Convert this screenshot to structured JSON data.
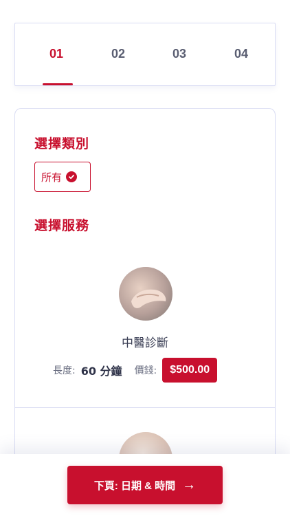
{
  "steps": [
    "01",
    "02",
    "03",
    "04"
  ],
  "category": {
    "title": "選擇類別",
    "chip": "所有"
  },
  "service": {
    "title": "選擇服務",
    "name": "中醫診斷",
    "duration_label": "長度:",
    "duration_value": "60 分鐘",
    "price_label": "價錢:",
    "price": "$500.00"
  },
  "cta": {
    "label": "下頁: 日期 & 時間",
    "icon": "arrow-right-icon"
  },
  "colors": {
    "accent": "#c8102e"
  }
}
